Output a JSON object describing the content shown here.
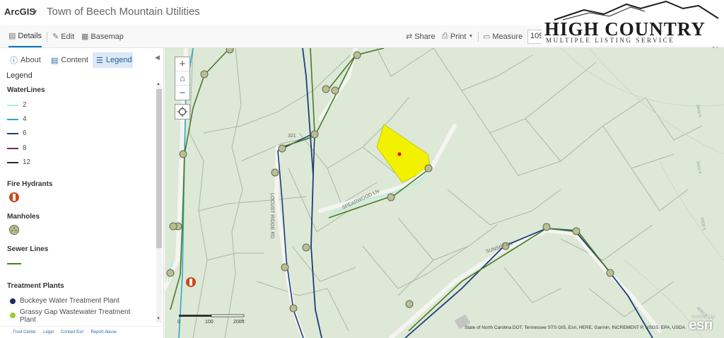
{
  "header": {
    "brand": "ArcGIS",
    "title": "Town of Beech Mountain Utilities"
  },
  "toolbar": {
    "details": "Details",
    "edit": "Edit",
    "basemap": "Basemap",
    "share": "Share",
    "print": "Print",
    "measure": "Measure",
    "search_value": "109"
  },
  "logo": {
    "title": "HIGH COUNTRY",
    "subtitle": "MULTIPLE LISTING SERVICE"
  },
  "panel": {
    "tabs": [
      "About",
      "Content",
      "Legend"
    ],
    "active_tab": "Legend",
    "legend_title": "Legend",
    "waterlines": {
      "title": "WaterLines",
      "items": [
        {
          "label": "2",
          "color": "#a8f0e0"
        },
        {
          "label": "4",
          "color": "#2ea8c8"
        },
        {
          "label": "6",
          "color": "#1f3d7a"
        },
        {
          "label": "8",
          "color": "#7a2a5a"
        },
        {
          "label": "12",
          "color": "#2a2a3a"
        }
      ]
    },
    "hydrants_title": "Fire Hydrants",
    "manholes_title": "Manholes",
    "sewer": {
      "title": "Sewer Lines",
      "color": "#4a7a2a"
    },
    "plants": {
      "title": "Treatment Plants",
      "items": [
        {
          "label": "Buckeye Water Treatment Plant",
          "color": "#1a2a6a"
        },
        {
          "label": "Grassy Gap Wastewater Treatment Plant",
          "color": "#9acd32"
        }
      ]
    },
    "footer": [
      "Trust Center",
      "Legal",
      "Contact Esri",
      "Report Abuse"
    ]
  },
  "map": {
    "roads": [
      "LOCUST RIDGE RD",
      "SPEARWOOD LN",
      "SUNSET LN"
    ],
    "route_number": "321",
    "contours": [
      "3840 ft",
      "3920 ft",
      "4000 ft",
      "4080 ft"
    ],
    "scale": {
      "labels": [
        "0",
        "100",
        "200ft"
      ]
    },
    "attribution": "State of North Carolina DOT, Tennessee STS GIS, Esri, HERE, Garmin, INCREMENT P, USGS, EPA, USDA",
    "esri": "esri",
    "esri_powered": "POWERED BY",
    "colors": {
      "parcel_highlight": "#f2f200",
      "selected_point": "#e00000",
      "map_bg": "#dde8d6",
      "parcel_lines": "#a9b8a9"
    }
  }
}
